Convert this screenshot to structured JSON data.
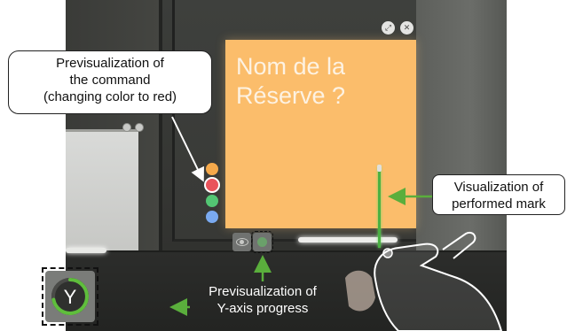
{
  "note": {
    "text": "Nom de la\nRéserve ?"
  },
  "note_controls": {
    "expand_glyph": "⤢",
    "close_glyph": "✕"
  },
  "palette": {
    "swatches": [
      {
        "name": "orange",
        "color": "#f5a94b",
        "selected": false
      },
      {
        "name": "red",
        "color": "#e9535b",
        "selected": true
      },
      {
        "name": "green",
        "color": "#53c673",
        "selected": false
      },
      {
        "name": "blue",
        "color": "#7aaaf0",
        "selected": false
      }
    ]
  },
  "y_progress": {
    "letter": "Y",
    "progress": 0.72,
    "color": "#5fbe3c"
  },
  "annotations": {
    "command_preview": "Previsualization of\nthe command\n(changing color to red)",
    "performed_mark": "Visualization of\nperformed mark",
    "y_axis_progress": "Previsualization of\nY-axis progress"
  },
  "colors": {
    "note": "#fbbd6b",
    "mark": "#4bb043",
    "arrow": "#5aae3c"
  }
}
